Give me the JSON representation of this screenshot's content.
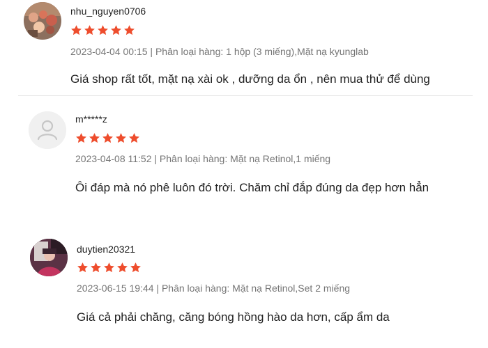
{
  "colors": {
    "star": "#ee4d2d",
    "meta_text": "#757575",
    "divider": "#e6e6e6",
    "default_avatar_bg": "#f0f0f0",
    "default_avatar_icon": "#c6c6c6"
  },
  "reviews": [
    {
      "username": "nhu_nguyen0706",
      "rating": 5,
      "meta": "2023-04-04 00:15 | Phân loại hàng: 1 hộp (3 miếng),Mặt nạ kyunglab",
      "comment": "Giá shop rất tốt, mặt nạ xài ok , dưỡng da ổn , nên mua thử để dùng",
      "avatar": "photo-avatar"
    },
    {
      "username": "m*****z",
      "rating": 5,
      "meta": "2023-04-08 11:52 | Phân loại hàng: Mặt nạ Retinol,1 miếng",
      "comment": "Ôi đáp mà nó phê luôn đó trời. Chăm chỉ đắp đúng da đẹp hơn hẳn",
      "avatar": "default-user-icon"
    },
    {
      "username": "duytien20321",
      "rating": 5,
      "meta": "2023-06-15 19:44 | Phân loại hàng: Mặt nạ Retinol,Set 2 miếng",
      "comment": "Giá cả phải chăng, căng bóng hồng hào da hơn, cấp ẩm da",
      "avatar": "photo-avatar"
    }
  ]
}
